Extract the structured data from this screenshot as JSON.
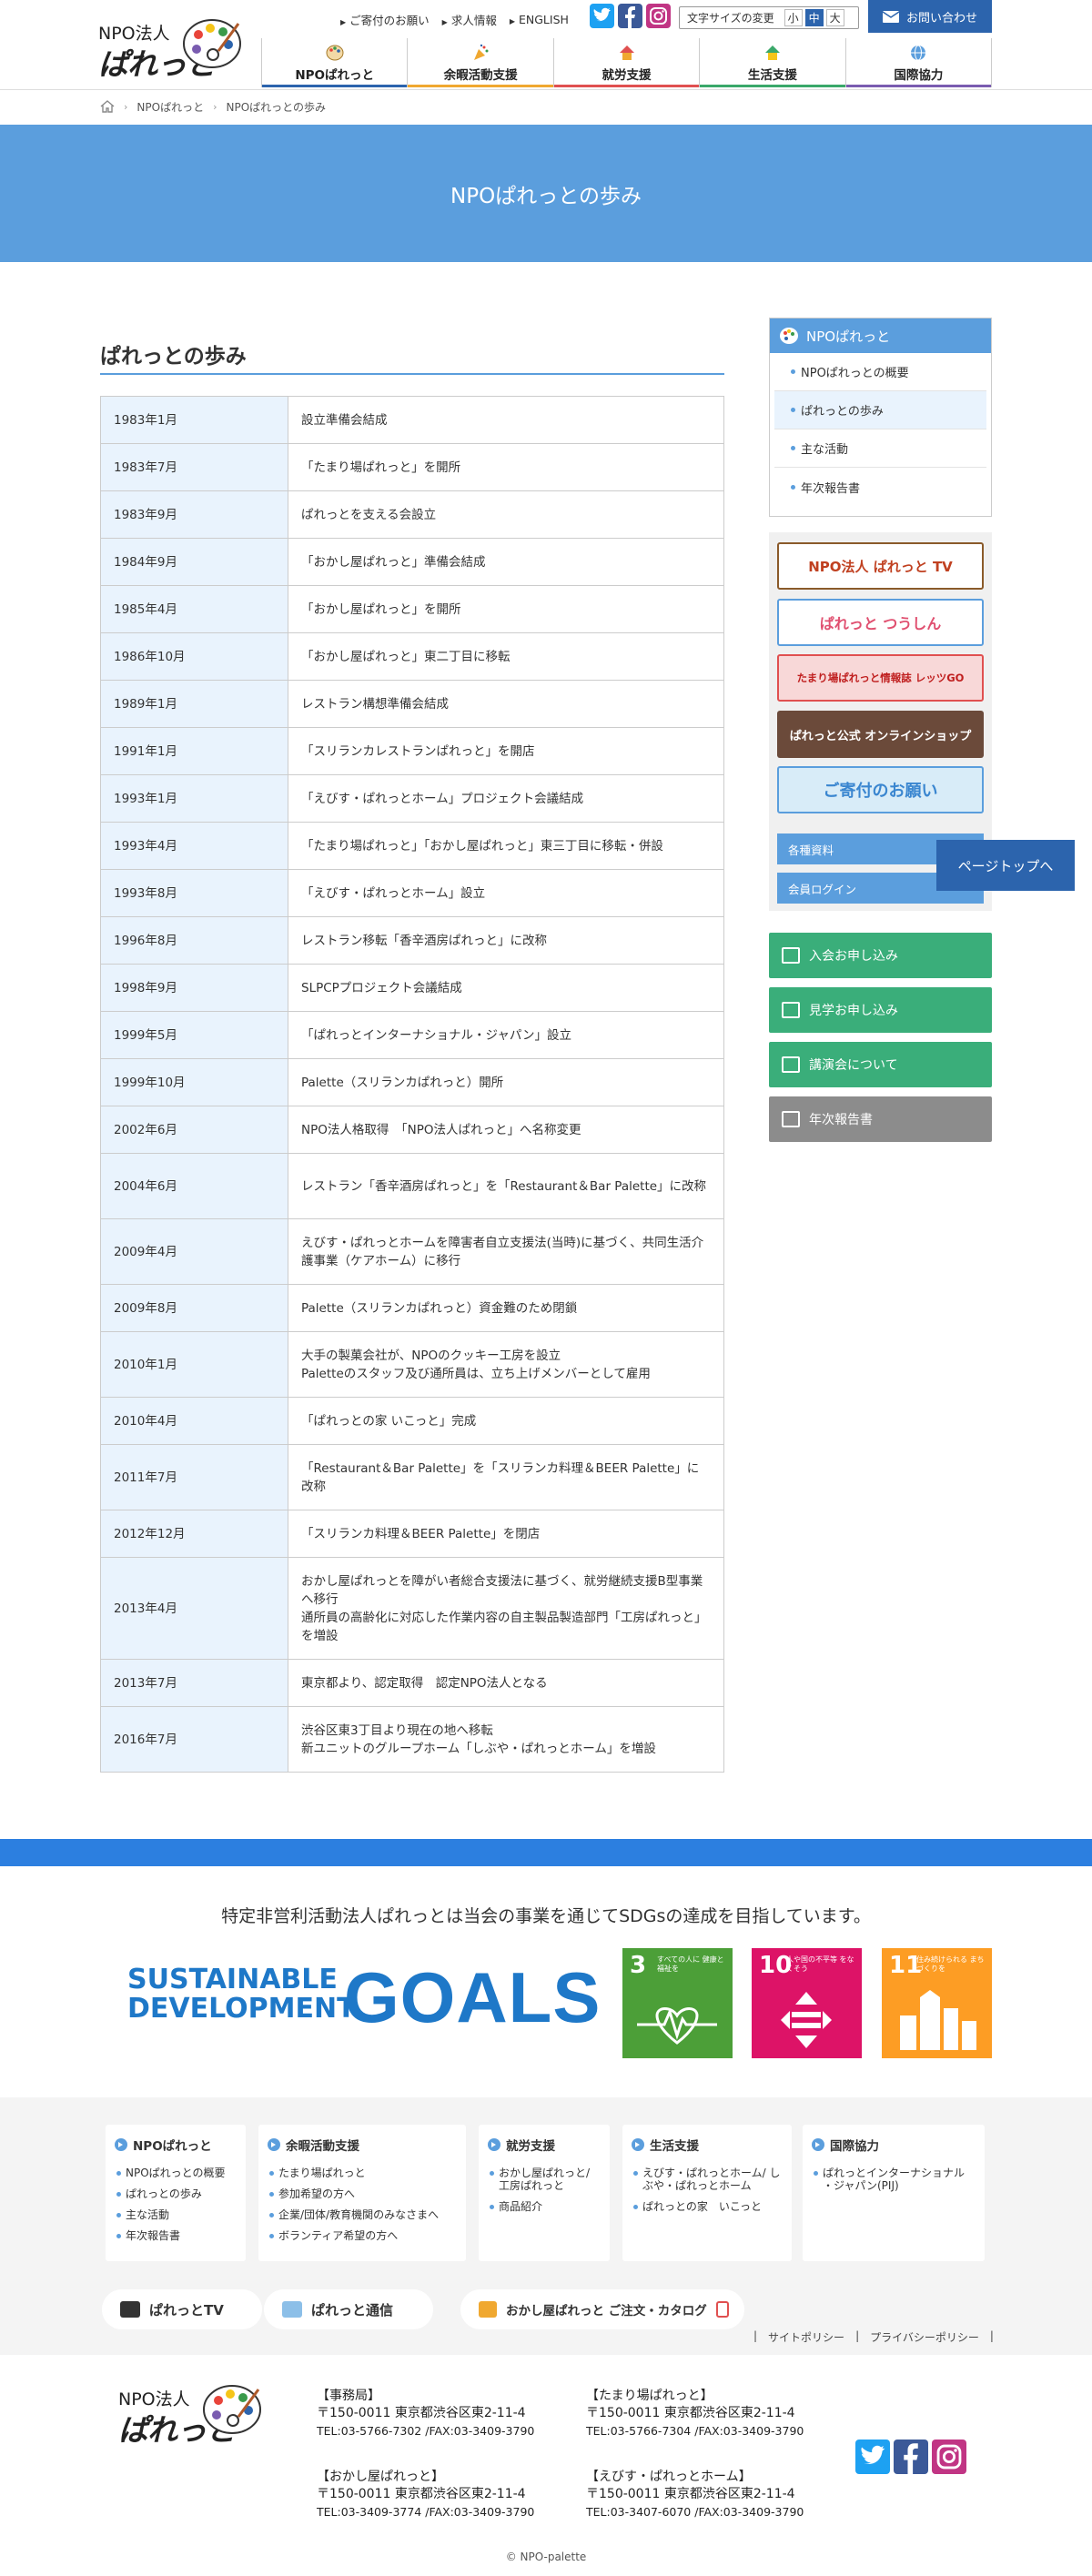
{
  "header": {
    "logo_npo": "NPO法人",
    "logo_brand": "ぱれっと",
    "util_links": [
      "ご寄付のお願い",
      "求人情報",
      "ENGLISH"
    ],
    "fontsize_label": "文字サイズの変更",
    "fontsize_options": [
      "小",
      "中",
      "大"
    ],
    "contact_label": "お問い合わせ",
    "nav": [
      {
        "label": "NPOぱれっと",
        "color": "#2c64ad"
      },
      {
        "label": "余暇活動支援",
        "color": "#f0a830"
      },
      {
        "label": "就労支援",
        "color": "#e05050"
      },
      {
        "label": "生活支援",
        "color": "#3aa86a"
      },
      {
        "label": "国際協力",
        "color": "#7a5cb0"
      }
    ]
  },
  "breadcrumb": {
    "items": [
      "NPOぱれっと",
      "NPOぱれっとの歩み"
    ]
  },
  "hero": {
    "title": "NPOぱれっとの歩み"
  },
  "main": {
    "title": "ぱれっとの歩み",
    "history": [
      {
        "date": "1983年1月",
        "event": "設立準備会結成"
      },
      {
        "date": "1983年7月",
        "event": "「たまり場ぱれっと」を開所"
      },
      {
        "date": "1983年9月",
        "event": "ぱれっとを支える会設立"
      },
      {
        "date": "1984年9月",
        "event": "「おかし屋ぱれっと」準備会結成"
      },
      {
        "date": "1985年4月",
        "event": "「おかし屋ぱれっと」を開所"
      },
      {
        "date": "1986年10月",
        "event": "「おかし屋ぱれっと」東二丁目に移転"
      },
      {
        "date": "1989年1月",
        "event": "レストラン構想準備会結成"
      },
      {
        "date": "1991年1月",
        "event": "「スリランカレストランぱれっと」を開店"
      },
      {
        "date": "1993年1月",
        "event": "「えびす・ぱれっとホーム」プロジェクト会議結成"
      },
      {
        "date": "1993年4月",
        "event": "「たまり場ぱれっと」「おかし屋ぱれっと」東三丁目に移転・併設"
      },
      {
        "date": "1993年8月",
        "event": "「えびす・ぱれっとホーム」設立"
      },
      {
        "date": "1996年8月",
        "event": "レストラン移転「香辛酒房ぱれっと」に改称"
      },
      {
        "date": "1998年9月",
        "event": "SLPCPプロジェクト会議結成"
      },
      {
        "date": "1999年5月",
        "event": "「ぱれっとインターナショナル・ジャパン」設立"
      },
      {
        "date": "1999年10月",
        "event": "Palette（スリランカぱれっと）開所"
      },
      {
        "date": "2002年6月",
        "event": "NPO法人格取得　「NPO法人ぱれっと」へ名称変更"
      },
      {
        "date": "2004年6月",
        "event": "レストラン「香辛酒房ぱれっと」を「Restaurant＆Bar Palette」に改称"
      },
      {
        "date": "2009年4月",
        "event": "えびす・ぱれっとホームを障害者自立支援法(当時)に基づく、共同生活介護事業（ケアホーム）に移行"
      },
      {
        "date": "2009年8月",
        "event": "Palette（スリランカぱれっと）資金難のため閉鎖"
      },
      {
        "date": "2010年1月",
        "event": "大手の製菓会社が、NPOのクッキー工房を設立\nPaletteのスタッフ及び通所員は、立ち上げメンバーとして雇用"
      },
      {
        "date": "2010年4月",
        "event": "「ぱれっとの家 いこっと」完成"
      },
      {
        "date": "2011年7月",
        "event": "「Restaurant＆Bar Palette」を「スリランカ料理＆BEER Palette」に改称"
      },
      {
        "date": "2012年12月",
        "event": "「スリランカ料理＆BEER Palette」を閉店"
      },
      {
        "date": "2013年4月",
        "event": "おかし屋ぱれっとを障がい者総合支援法に基づく、就労継続支援B型事業へ移行\n通所員の高齢化に対応した作業内容の自主製品製造部門「工房ぱれっと」を増設"
      },
      {
        "date": "2013年7月",
        "event": "東京都より、認定取得　認定NPO法人となる"
      },
      {
        "date": "2016年7月",
        "event": "渋谷区東3丁目より現在の地へ移転\n新ユニットのグループホーム「しぶや・ぱれっとホーム」を増設"
      }
    ]
  },
  "sidebar": {
    "head": "NPOぱれっと",
    "items": [
      "NPOぱれっとの概要",
      "ぱれっとの歩み",
      "主な活動",
      "年次報告書"
    ],
    "banners": [
      "NPO法人 ぱれっと TV",
      "ぱれっと つうしん",
      "たまり場ぱれっと情報誌 レッツGO",
      "ぱれっと公式 オンラインショップ",
      "ご寄付のお願い"
    ],
    "links": [
      "各種資料",
      "会員ログイン"
    ],
    "actions": [
      {
        "label": "入会お申し込み",
        "color": "#3aae7a"
      },
      {
        "label": "見学お申し込み",
        "color": "#3aae7a"
      },
      {
        "label": "講演会について",
        "color": "#3aae7a"
      },
      {
        "label": "年次報告書",
        "color": "#8c8c8c"
      }
    ]
  },
  "pagetop_label": "ページトップへ",
  "sdgs": {
    "text": "特定非営利活動法人ぱれっとは当会の事業を通じてSDGsの達成を目指しています。",
    "logo_line1": "SUSTAINABLE",
    "logo_line2": "DEVELOPMENT",
    "logo_goals": "GOALS",
    "goals": [
      {
        "num": "3",
        "text": "すべての人に 健康と福祉を",
        "color": "#4c9f38"
      },
      {
        "num": "10",
        "text": "人や国の不平等 をなくそう",
        "color": "#dd1367"
      },
      {
        "num": "11",
        "text": "住み続けられる まちづくりを",
        "color": "#fd9d24"
      }
    ]
  },
  "footer_nav": [
    {
      "title": "NPOぱれっと",
      "items": [
        "NPOぱれっとの概要",
        "ぱれっとの歩み",
        "主な活動",
        "年次報告書"
      ]
    },
    {
      "title": "余暇活動支援",
      "items": [
        "たまり場ぱれっと",
        "参加希望の方へ",
        "企業/団体/教育機関のみなさまへ",
        "ボランティア希望の方へ"
      ]
    },
    {
      "title": "就労支援",
      "items": [
        "おかし屋ぱれっと/ 工房ぱれっと",
        "商品紹介"
      ]
    },
    {
      "title": "生活支援",
      "items": [
        "えびす・ぱれっとホーム/ しぶや・ぱれっとホーム",
        "ぱれっとの家　いこっと"
      ]
    },
    {
      "title": "国際協力",
      "items": [
        "ぱれっとインターナショナル ・ジャパン(PIJ)"
      ]
    }
  ],
  "footer_pills": [
    "ぱれっとTV",
    "ぱれっと通信",
    "おかし屋ぱれっと ご注文・カタログ"
  ],
  "policies": [
    "サイトポリシー",
    "プライバシーポリシー"
  ],
  "addresses": [
    {
      "title": "【事務局】",
      "addr": "〒150-0011 東京都渋谷区東2-11-4",
      "tel": "TEL:03-5766-7302 /FAX:03-3409-3790"
    },
    {
      "title": "【たまり場ぱれっと】",
      "addr": "〒150-0011 東京都渋谷区東2-11-4",
      "tel": "TEL:03-5766-7304 /FAX:03-3409-3790"
    },
    {
      "title": "【おかし屋ぱれっと】",
      "addr": "〒150-0011 東京都渋谷区東2-11-4",
      "tel": "TEL:03-3409-3774 /FAX:03-3409-3790"
    },
    {
      "title": "【えびす・ぱれっとホーム】",
      "addr": "〒150-0011 東京都渋谷区東2-11-4",
      "tel": "TEL:03-3407-6070 /FAX:03-3409-3790"
    }
  ],
  "copyright": "© NPO-palette"
}
